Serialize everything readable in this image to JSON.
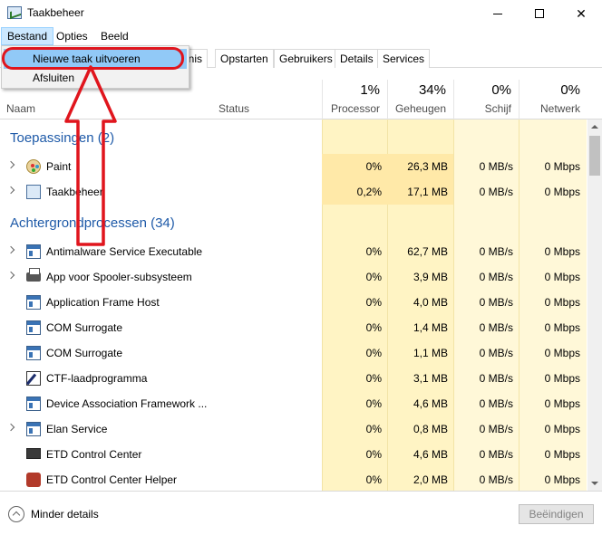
{
  "window": {
    "title": "Taakbeheer"
  },
  "menu": {
    "items": [
      "Bestand",
      "Opties",
      "Beeld"
    ]
  },
  "dropdown": {
    "items": [
      "Nieuwe taak uitvoeren",
      "Afsluiten"
    ]
  },
  "tabs": [
    "enis",
    "Opstarten",
    "Gebruikers",
    "Details",
    "Services"
  ],
  "columns": {
    "name": "Naam",
    "status": "Status",
    "cpu": {
      "pct": "1%",
      "label": "Processor"
    },
    "mem": {
      "pct": "34%",
      "label": "Geheugen"
    },
    "disk": {
      "pct": "0%",
      "label": "Schijf"
    },
    "net": {
      "pct": "0%",
      "label": "Netwerk"
    }
  },
  "groups": {
    "apps": "Toepassingen (2)",
    "background": "Achtergrondprocessen (34)"
  },
  "apps": [
    {
      "name": "Paint",
      "cpu": "0%",
      "mem": "26,3 MB",
      "disk": "0 MB/s",
      "net": "0 Mbps",
      "icon": "paint-icon"
    },
    {
      "name": "Taakbeheer",
      "cpu": "0,2%",
      "mem": "17,1 MB",
      "disk": "0 MB/s",
      "net": "0 Mbps",
      "icon": "task-manager-icon"
    }
  ],
  "background": [
    {
      "name": "Antimalware Service Executable",
      "cpu": "0%",
      "mem": "62,7 MB",
      "disk": "0 MB/s",
      "net": "0 Mbps",
      "icon": "window-icon"
    },
    {
      "name": "App voor Spooler-subsysteem",
      "cpu": "0%",
      "mem": "3,9 MB",
      "disk": "0 MB/s",
      "net": "0 Mbps",
      "icon": "printer-icon"
    },
    {
      "name": "Application Frame Host",
      "cpu": "0%",
      "mem": "4,0 MB",
      "disk": "0 MB/s",
      "net": "0 Mbps",
      "icon": "window-icon"
    },
    {
      "name": "COM Surrogate",
      "cpu": "0%",
      "mem": "1,4 MB",
      "disk": "0 MB/s",
      "net": "0 Mbps",
      "icon": "window-icon"
    },
    {
      "name": "COM Surrogate",
      "cpu": "0%",
      "mem": "1,1 MB",
      "disk": "0 MB/s",
      "net": "0 Mbps",
      "icon": "window-icon"
    },
    {
      "name": "CTF-laadprogramma",
      "cpu": "0%",
      "mem": "3,1 MB",
      "disk": "0 MB/s",
      "net": "0 Mbps",
      "icon": "pen-icon"
    },
    {
      "name": "Device Association Framework ...",
      "cpu": "0%",
      "mem": "4,6 MB",
      "disk": "0 MB/s",
      "net": "0 Mbps",
      "icon": "window-icon"
    },
    {
      "name": "Elan Service",
      "cpu": "0%",
      "mem": "0,8 MB",
      "disk": "0 MB/s",
      "net": "0 Mbps",
      "icon": "window-icon"
    },
    {
      "name": "ETD Control Center",
      "cpu": "0%",
      "mem": "4,6 MB",
      "disk": "0 MB/s",
      "net": "0 Mbps",
      "icon": "monitor-icon"
    },
    {
      "name": "ETD Control Center Helper",
      "cpu": "0%",
      "mem": "2,0 MB",
      "disk": "0 MB/s",
      "net": "0 Mbps",
      "icon": "flame-icon"
    }
  ],
  "footer": {
    "less_details": "Minder details",
    "end_task": "Beëindigen"
  },
  "colors": {
    "accent": "#1e5aa8",
    "highlight": "#91c9f7",
    "annotation": "#e0151d",
    "cpu_bg": "#fff4c4"
  }
}
